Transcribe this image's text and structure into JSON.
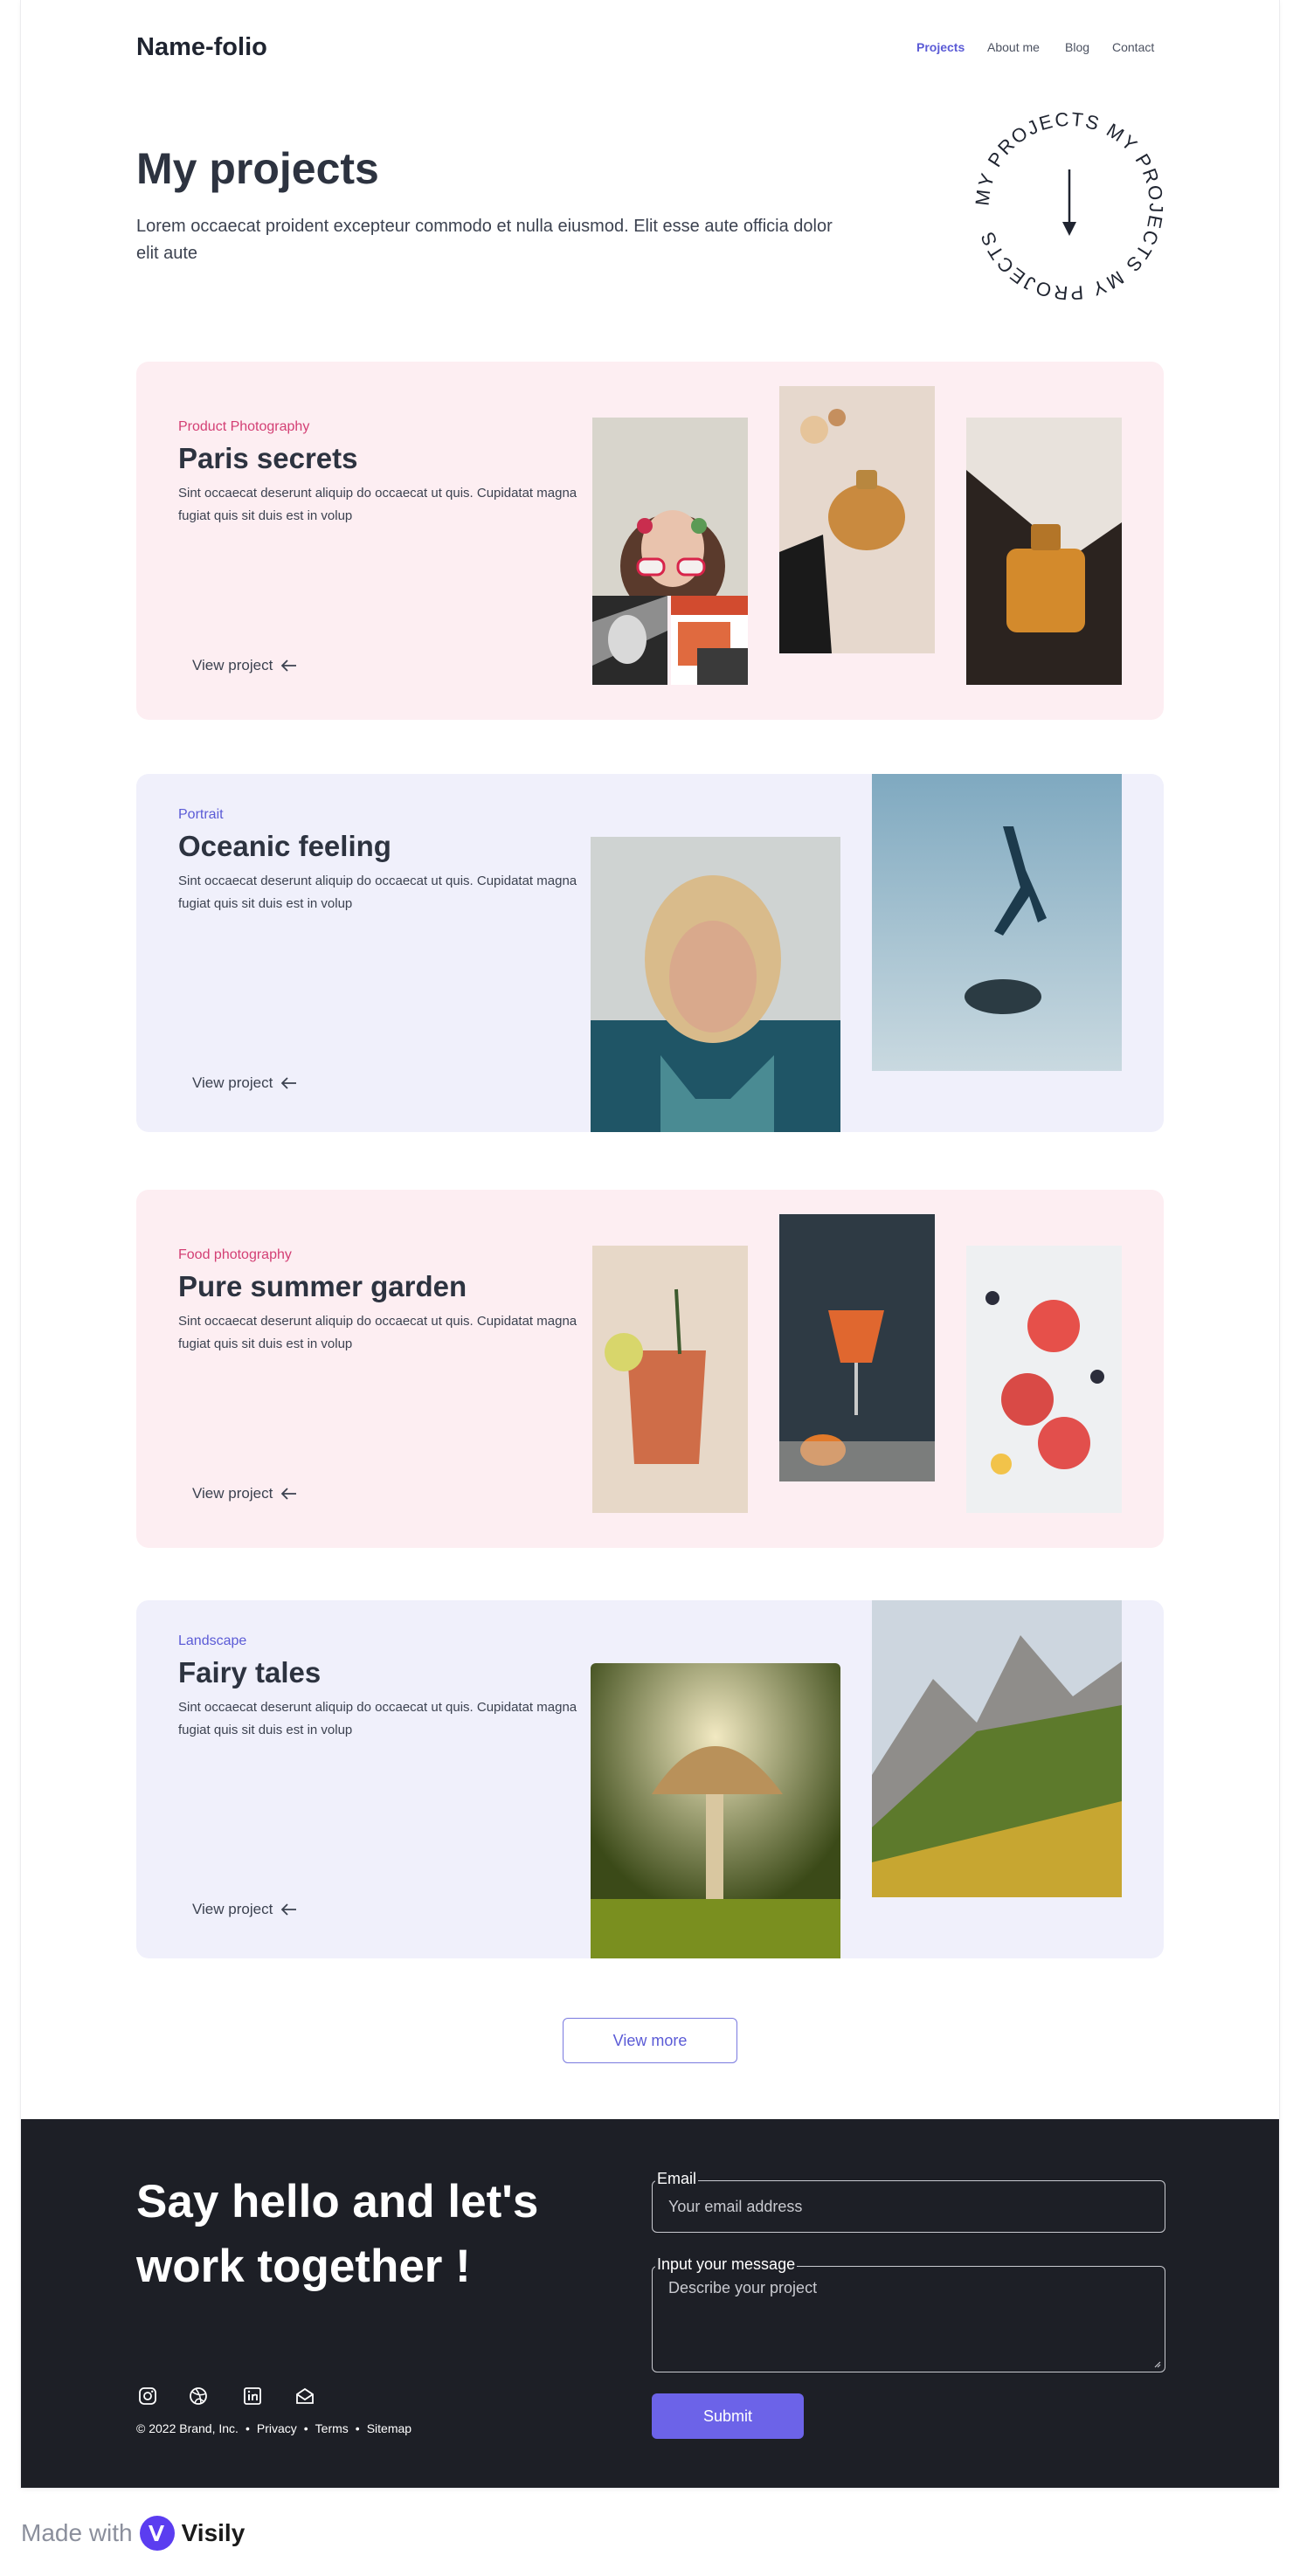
{
  "brand": "Name-folio",
  "nav": {
    "items": [
      {
        "label": "Projects",
        "active": true
      },
      {
        "label": "About me",
        "active": false
      },
      {
        "label": "Blog",
        "active": false
      },
      {
        "label": "Contact",
        "active": false
      }
    ]
  },
  "hero": {
    "title": "My projects",
    "subtitle": "Lorem occaecat proident excepteur commodo et nulla eiusmod. Elit esse aute officia dolor elit aute",
    "badge_text": "MY PROJECTS MY PROJECTS MY PROJECTS "
  },
  "projects": [
    {
      "category": "Product Photography",
      "title": "Paris secrets",
      "description": "Sint occaecat deserunt aliquip do occaecat ut quis. Cupidatat magna fugiat quis sit duis est in volup",
      "link": "View project"
    },
    {
      "category": "Portrait",
      "title": "Oceanic feeling",
      "description": "Sint occaecat deserunt aliquip do occaecat ut quis. Cupidatat magna fugiat quis sit duis est in volup",
      "link": "View project"
    },
    {
      "category": "Food photography",
      "title": "Pure summer garden",
      "description": "Sint occaecat deserunt aliquip do occaecat ut quis. Cupidatat magna fugiat quis sit duis est in volup",
      "link": "View project"
    },
    {
      "category": "Landscape",
      "title": "Fairy tales",
      "description": "Sint occaecat deserunt aliquip do occaecat ut quis. Cupidatat magna fugiat quis sit duis est in volup",
      "link": "View project"
    }
  ],
  "view_more": "View more",
  "footer": {
    "title": "Say hello and let's work together !",
    "email_label": "Email",
    "email_placeholder": "Your email address",
    "message_label": "Input your message",
    "message_placeholder": "Describe your project",
    "submit": "Submit",
    "copyright": "© 2022 Brand, Inc.",
    "links": [
      "Privacy",
      "Terms",
      "Sitemap"
    ],
    "social_icons": [
      "instagram-icon",
      "dribbble-icon",
      "linkedin-icon",
      "mail-icon"
    ]
  },
  "made_with": {
    "prefix": "Made with",
    "brand": "Visily"
  },
  "colors": {
    "accent": "#5b5bd6",
    "pink_card": "#fdeef2",
    "lavender_card": "#f0f0fb",
    "footer_bg": "#1d1f26",
    "category_pink": "#d33f74",
    "submit": "#6c63e8"
  }
}
